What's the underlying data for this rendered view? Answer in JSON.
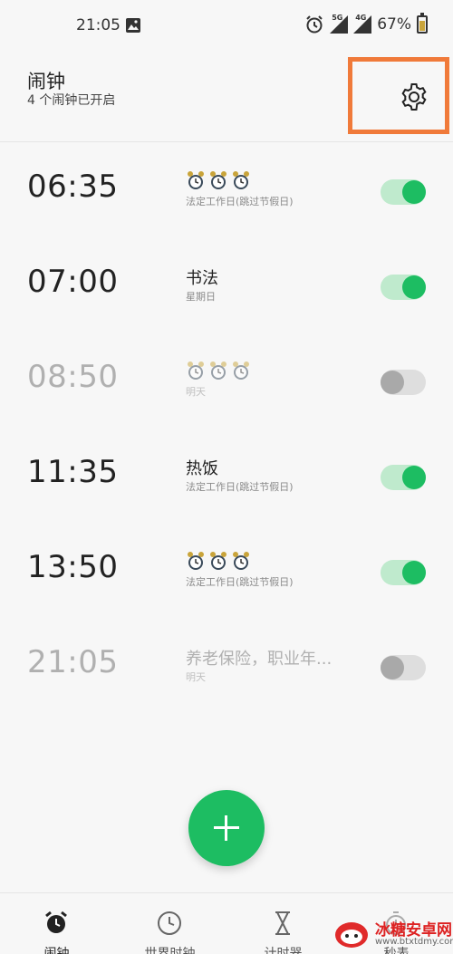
{
  "status_bar": {
    "time": "21:05",
    "network_1": "5G",
    "network_2": "4G",
    "battery": "67%",
    "battery_level": 0.67
  },
  "header": {
    "title": "闹钟",
    "subtitle": "4 个闹钟已开启"
  },
  "alarms": [
    {
      "time": "06:35",
      "label": "",
      "label_icons": "alarm-clock-icon x3",
      "repeat": "法定工作日(跳过节假日)",
      "enabled": true
    },
    {
      "time": "07:00",
      "label": "书法",
      "repeat": "星期日",
      "enabled": true
    },
    {
      "time": "08:50",
      "label": "",
      "label_icons": "alarm-clock-icon x3",
      "repeat": "明天",
      "enabled": false
    },
    {
      "time": "11:35",
      "label": "热饭",
      "repeat": "法定工作日(跳过节假日)",
      "enabled": true
    },
    {
      "time": "13:50",
      "label": "",
      "label_icons": "alarm-clock-icon x3",
      "repeat": "法定工作日(跳过节假日)",
      "enabled": true
    },
    {
      "time": "21:05",
      "label": "养老保险，职业年...",
      "repeat": "明天",
      "enabled": false
    }
  ],
  "fab": {
    "icon": "plus-icon"
  },
  "bottom_nav": [
    {
      "label": "闹钟",
      "icon": "alarm-clock-icon",
      "active": true
    },
    {
      "label": "世界时钟",
      "icon": "clock-icon",
      "active": false
    },
    {
      "label": "计时器",
      "icon": "hourglass-icon",
      "active": false
    },
    {
      "label": "秒表",
      "icon": "stopwatch-icon",
      "active": false
    }
  ],
  "watermark": {
    "name": "冰糖安卓网",
    "url": "www.btxtdmy.com"
  },
  "colors": {
    "accent": "#1dbd62",
    "highlight_box": "#f07a3a",
    "toggle_off": "#a9a9a9"
  }
}
